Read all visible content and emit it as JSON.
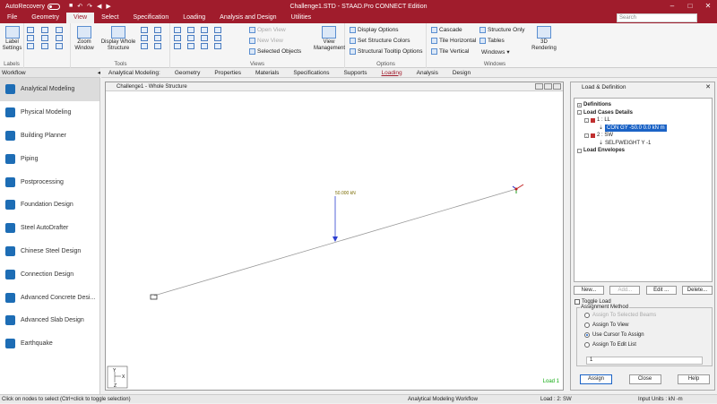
{
  "titlebar": {
    "autorecovery": "AutoRecovery",
    "title": "Challenge1.STD - STAAD.Pro CONNECT Edition",
    "qat_icons": [
      "save-icon",
      "undo-icon",
      "redo-icon",
      "back-icon",
      "forward-icon"
    ]
  },
  "menu": {
    "tabs": [
      "File",
      "Geometry",
      "View",
      "Select",
      "Specification",
      "Loading",
      "Analysis and Design",
      "Utilities"
    ],
    "active": "View",
    "search_placeholder": "Search"
  },
  "ribbon": {
    "labels_group": {
      "button": "Label Settings",
      "label": "Labels"
    },
    "tools_group": {
      "zoom": "Zoom Window",
      "display": "Display Whole Structure",
      "label": "Tools"
    },
    "views_group": {
      "open_view": "Open View",
      "new_view": "New View",
      "selected_objects": "Selected Objects",
      "view_management": "View Management",
      "label": "Views"
    },
    "options_group": {
      "display_options": "Display Options",
      "set_colors": "Set Structure Colors",
      "tooltip_options": "Structural Tooltip Options",
      "label": "Options"
    },
    "windows_group": {
      "cascade": "Cascade",
      "tile_h": "Tile Horizontal",
      "tile_v": "Tile Vertical",
      "structure_only": "Structure Only",
      "tables": "Tables",
      "windows": "Windows",
      "rendering": "3D Rendering",
      "label": "Windows"
    }
  },
  "workflow": {
    "header": "Workflow",
    "items": [
      "Analytical Modeling",
      "Physical Modeling",
      "Building Planner",
      "Piping",
      "Postprocessing",
      "Foundation Design",
      "Steel AutoDrafter",
      "Chinese Steel Design",
      "Connection Design",
      "Advanced Concrete Desi...",
      "Advanced Slab Design",
      "Earthquake"
    ]
  },
  "subtabs": {
    "prefix": "Analytical Modeling:",
    "tabs": [
      "Geometry",
      "Properties",
      "Materials",
      "Specifications",
      "Supports",
      "Loading",
      "Analysis",
      "Design"
    ],
    "active": "Loading"
  },
  "viewport": {
    "title": "Challenge1 - Whole Structure",
    "load_value": "50.000 kN",
    "load_tag": "Load 1",
    "axis_y": "Y",
    "axis_x": "X",
    "axis_z": "Z"
  },
  "panel": {
    "title": "Load & Definition",
    "tree": {
      "definitions": "Definitions",
      "load_cases": "Load Cases Details",
      "case1": "1 : LL",
      "case1_item": "CON GY -50.0 0.0 kN m",
      "case2": "2 : SW",
      "case2_item": "SELFWEIGHT Y -1",
      "envelopes": "Load Envelopes"
    },
    "buttons": {
      "new": "New...",
      "add": "Add...",
      "edit": "Edit ...",
      "delete": "Delete..."
    },
    "toggle_load": "Toggle Load",
    "assignment": {
      "legend": "Assignment Method",
      "opt1": "Assign To Selected Beams",
      "opt2": "Assign To View",
      "opt3": "Use Cursor To Assign",
      "opt4": "Assign To Edit List",
      "value": "1"
    },
    "bottom": {
      "assign": "Assign",
      "close": "Close",
      "help": "Help"
    }
  },
  "status": {
    "left": "Click on nodes to select (Ctrl+click to toggle selection)",
    "workflow": "Analytical Modeling Workflow",
    "load": "Load : 2: SW",
    "units": "Input Units : kN -m"
  }
}
